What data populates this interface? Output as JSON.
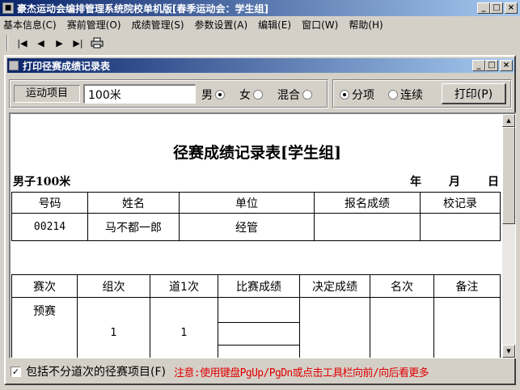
{
  "app": {
    "title": "豪杰运动会编排管理系统院校单机版[春季运动会：学生组]"
  },
  "menu": [
    {
      "label": "基本信息(C)"
    },
    {
      "label": "赛前管理(O)"
    },
    {
      "label": "成绩管理(S)"
    },
    {
      "label": "参数设置(A)"
    },
    {
      "label": "编辑(E)"
    },
    {
      "label": "窗口(W)"
    },
    {
      "label": "帮助(H)"
    }
  ],
  "toolbar": {
    "first": "|◀",
    "prev": "◀",
    "next": "▶",
    "last": "▶|",
    "print": "🖶"
  },
  "window": {
    "title": "打印径赛成绩记录表"
  },
  "controls": {
    "event_label": "运动项目",
    "event_value": "100米",
    "gender_options": [
      {
        "label": "男",
        "selected": true
      },
      {
        "label": "女",
        "selected": false
      },
      {
        "label": "混合",
        "selected": false
      }
    ],
    "mode_options": [
      {
        "label": "分项",
        "selected": true
      },
      {
        "label": "连续",
        "selected": false
      }
    ],
    "print_label": "打印(P)"
  },
  "report": {
    "title": "径赛成绩记录表[学生组]",
    "subtitle": "男子100米",
    "date": {
      "year": "年",
      "month": "月",
      "day": "日"
    },
    "table1": {
      "headers": [
        "号码",
        "姓名",
        "单位",
        "报名成绩",
        "校记录"
      ],
      "rows": [
        [
          "00214",
          "马不都一郎",
          "经管",
          "",
          ""
        ]
      ]
    },
    "table2": {
      "headers": [
        "赛次",
        "组次",
        "道1次",
        "比赛成绩",
        "决定成绩",
        "名次",
        "备注"
      ],
      "round": "预赛",
      "group": "1",
      "lane": "1"
    }
  },
  "footer": {
    "checkbox_checked": true,
    "checkbox_label": "包括不分道次的径赛项目(F)",
    "note": "注意:使用键盘PgUp/PgDn或点击工具栏向前/向后看更多"
  }
}
